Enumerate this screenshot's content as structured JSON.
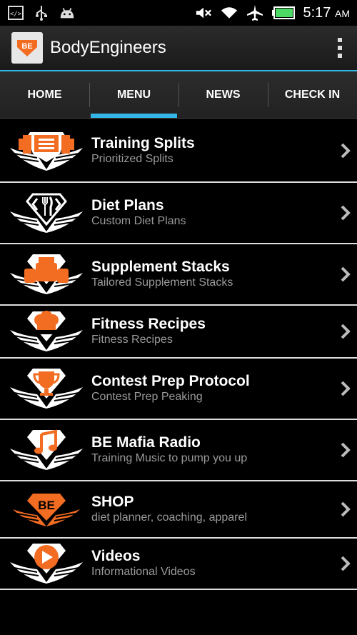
{
  "status_bar": {
    "icons_left": [
      "code-icon",
      "usb-icon",
      "android-icon"
    ],
    "icons_right": [
      "mute-icon",
      "wifi-icon",
      "airplane-icon",
      "battery-icon"
    ],
    "time": "5:17",
    "ampm": "AM"
  },
  "action_bar": {
    "title": "BodyEngineers",
    "logo_text": "BE",
    "overflow_icon": "overflow-menu-icon"
  },
  "tabs": [
    {
      "label": "HOME",
      "active": false
    },
    {
      "label": "MENU",
      "active": true
    },
    {
      "label": "NEWS",
      "active": false
    },
    {
      "label": "CHECK IN",
      "active": false
    }
  ],
  "menu": [
    {
      "title": "Training Splits",
      "subtitle": "Prioritized Splits",
      "icon": "dumbbell-icon"
    },
    {
      "title": "Diet Plans",
      "subtitle": "Custom Diet Plans",
      "icon": "fork-knife-icon"
    },
    {
      "title": "Supplement Stacks",
      "subtitle": "Tailored Supplement Stacks",
      "icon": "supplement-jars-icon"
    },
    {
      "title": "Fitness Recipes",
      "subtitle": "Fitness Recipes",
      "icon": "chef-hat-icon"
    },
    {
      "title": "Contest Prep Protocol",
      "subtitle": "Contest Prep Peaking",
      "icon": "trophy-icon"
    },
    {
      "title": "BE Mafia Radio",
      "subtitle": "Training Music to pump you up",
      "icon": "music-note-icon"
    },
    {
      "title": "SHOP",
      "subtitle": "diet planner, coaching, apparel",
      "icon": "be-logo-icon"
    },
    {
      "title": "Videos",
      "subtitle": "Informational Videos",
      "icon": "play-icon"
    }
  ],
  "colors": {
    "accent": "#33b5e5",
    "brand_orange": "#f26c22",
    "battery_green": "#4cd964"
  }
}
